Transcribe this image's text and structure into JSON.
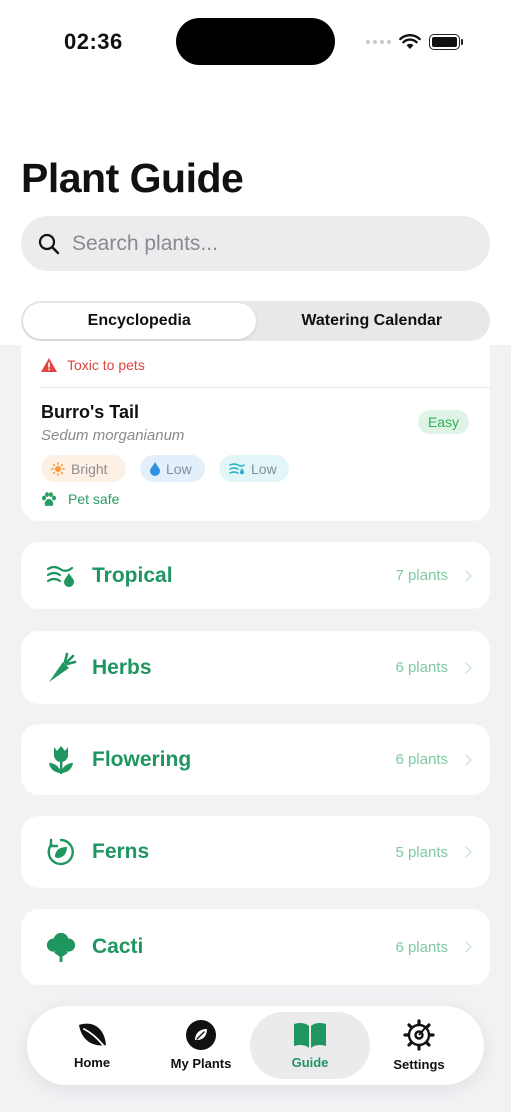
{
  "status": {
    "time": "02:36"
  },
  "header": {
    "title": "Plant Guide"
  },
  "search": {
    "placeholder": "Search plants..."
  },
  "segments": {
    "encyclopedia": "Encyclopedia",
    "watering": "Watering Calendar"
  },
  "previous_card": {
    "toxic_label": "Toxic to pets"
  },
  "plant_card": {
    "name": "Burro's Tail",
    "scientific": "Sedum morganianum",
    "difficulty": "Easy",
    "light": "Bright",
    "water": "Low",
    "humidity": "Low",
    "pet_label": "Pet safe"
  },
  "categories": [
    {
      "name": "Tropical",
      "count": "7 plants",
      "icon": "humidity-drop-icon"
    },
    {
      "name": "Herbs",
      "count": "6 plants",
      "icon": "carrot-icon"
    },
    {
      "name": "Flowering",
      "count": "6 plants",
      "icon": "tulip-icon"
    },
    {
      "name": "Ferns",
      "count": "5 plants",
      "icon": "leaf-cycle-icon"
    },
    {
      "name": "Cacti",
      "count": "6 plants",
      "icon": "tree-icon"
    }
  ],
  "tabs": [
    {
      "label": "Home",
      "icon": "leaf-icon"
    },
    {
      "label": "My Plants",
      "icon": "leaf-circle-icon"
    },
    {
      "label": "Guide",
      "icon": "book-icon"
    },
    {
      "label": "Settings",
      "icon": "gear-icon"
    }
  ],
  "colors": {
    "accent": "#1f9560",
    "danger": "#e0453f",
    "easy": "#2bb35a"
  }
}
